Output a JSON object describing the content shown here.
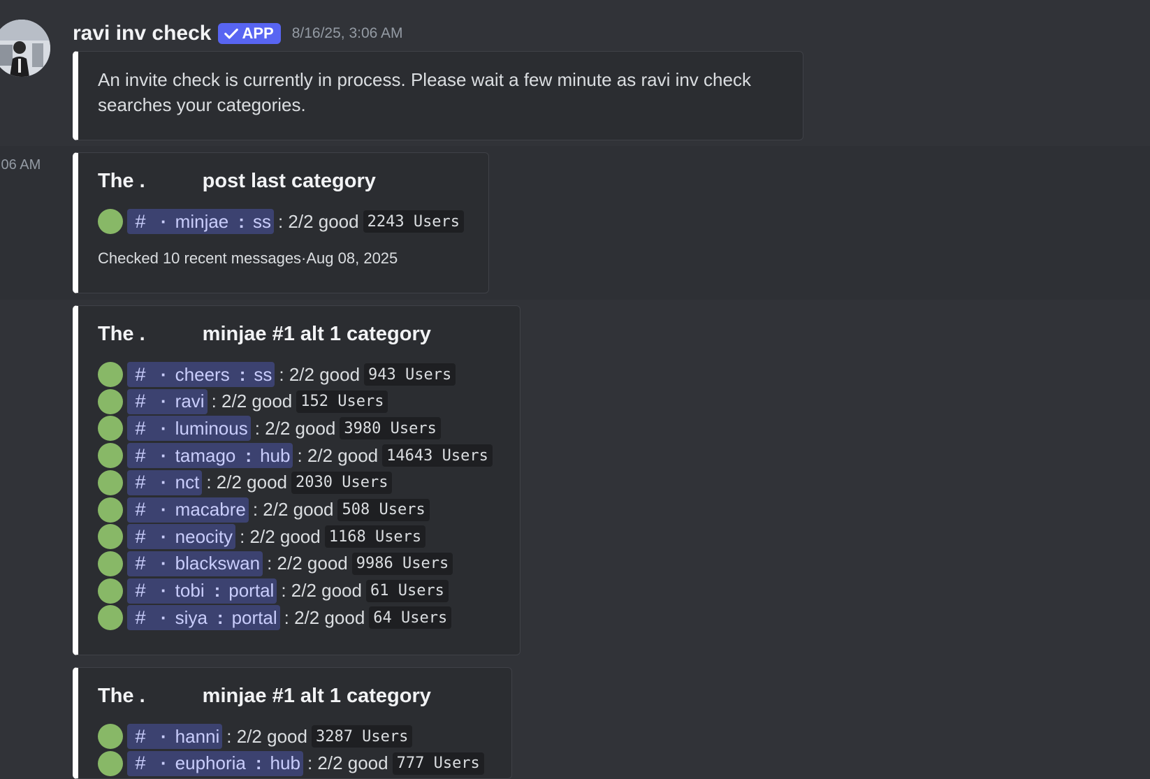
{
  "message": {
    "username": "ravi inv check",
    "badge": "APP",
    "timestamp": "8/16/25, 3:06 AM",
    "description": [
      "An invite check is currently in process. Please wait a few minute as ravi inv check",
      "searches your categories."
    ]
  },
  "side_time": ":06 AM",
  "embeds": [
    {
      "title_prefix": "The .",
      "title": "post last category",
      "rows": [
        {
          "channel": "minjae",
          "suffix": "ss",
          "status": ": 2/2 good",
          "users": "2243  Users"
        }
      ],
      "footer": "Checked 10 recent messages·Aug 08, 2025"
    },
    {
      "title_prefix": "The .",
      "title": "minjae #1 alt 1 category",
      "rows": [
        {
          "channel": "cheers",
          "suffix": "ss",
          "status": ": 2/2 good",
          "users": "943  Users"
        },
        {
          "channel": "ravi",
          "suffix": "",
          "status": ": 2/2 good",
          "users": "152  Users"
        },
        {
          "channel": "luminous",
          "suffix": "",
          "status": ": 2/2 good",
          "users": "3980  Users"
        },
        {
          "channel": "tamago",
          "suffix": "hub",
          "status": ": 2/2 good",
          "users": "14643  Users"
        },
        {
          "channel": "nct",
          "suffix": "",
          "status": ": 2/2 good",
          "users": "2030  Users"
        },
        {
          "channel": "macabre",
          "suffix": "",
          "status": ": 2/2 good",
          "users": "508  Users"
        },
        {
          "channel": "neocity",
          "suffix": "",
          "status": ": 2/2 good",
          "users": "1168  Users"
        },
        {
          "channel": "blackswan",
          "suffix": "",
          "status": ": 2/2 good",
          "users": "9986  Users"
        },
        {
          "channel": "tobi",
          "suffix": "portal",
          "status": ": 2/2 good",
          "users": "61  Users"
        },
        {
          "channel": "siya",
          "suffix": "portal",
          "status": ": 2/2 good",
          "users": "64  Users"
        }
      ]
    },
    {
      "title_prefix": "The .",
      "title": "minjae #1 alt 1 category",
      "rows": [
        {
          "channel": "hanni",
          "suffix": "",
          "status": ": 2/2 good",
          "users": "3287  Users"
        },
        {
          "channel": "euphoria",
          "suffix": "hub",
          "status": ": 2/2 good",
          "users": "777  Users"
        }
      ]
    }
  ]
}
